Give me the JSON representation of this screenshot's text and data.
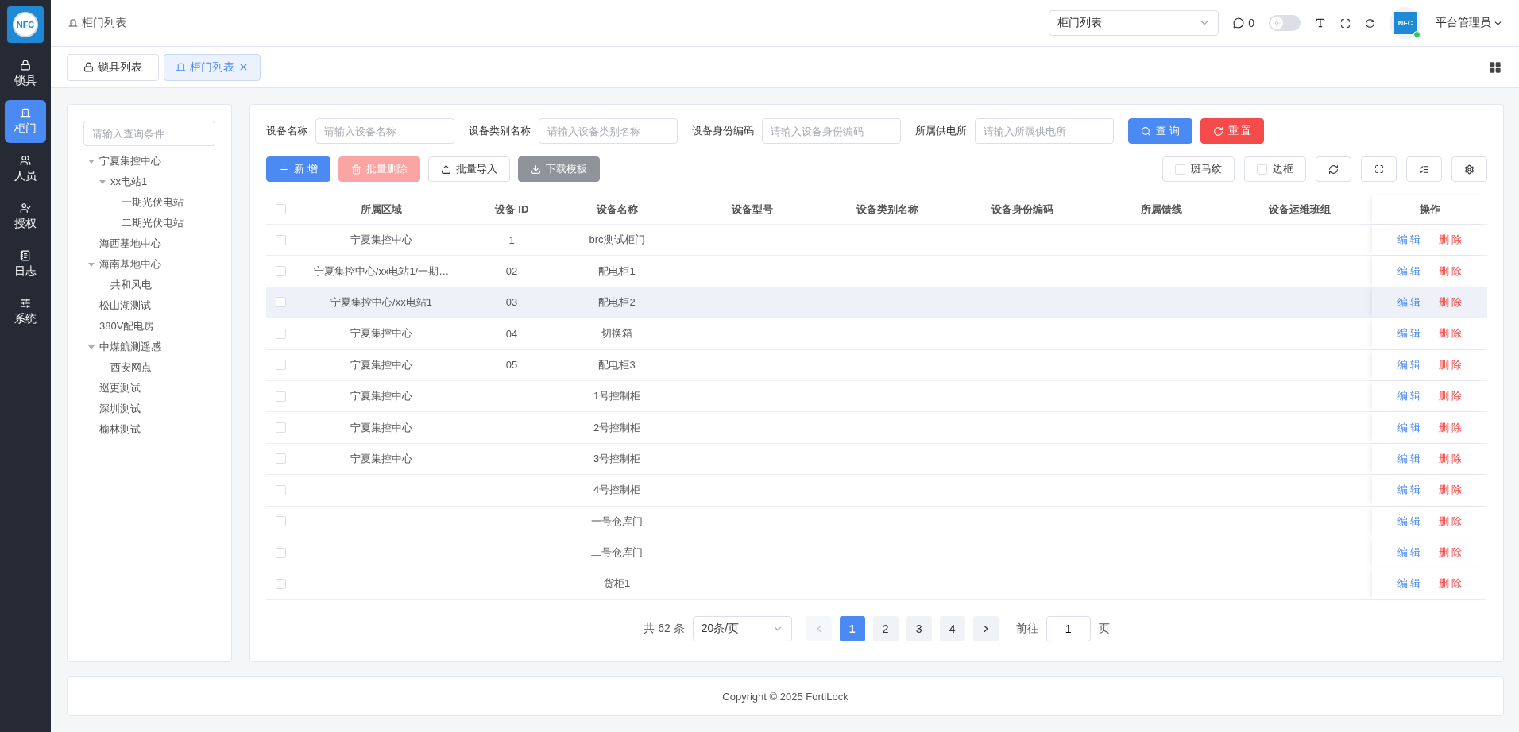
{
  "app": {
    "logo": "NFC"
  },
  "sidebar": {
    "items": [
      {
        "label": "锁具",
        "selected": false
      },
      {
        "label": "柜门",
        "selected": true
      },
      {
        "label": "人员",
        "selected": false
      },
      {
        "label": "授权",
        "selected": false
      },
      {
        "label": "日志",
        "selected": false
      },
      {
        "label": "系统",
        "selected": false
      }
    ]
  },
  "header": {
    "breadcrumb": "柜门列表",
    "menu_select": "柜门列表",
    "messages": "0",
    "dark_mode": {
      "on": false
    },
    "avatar": "NFC",
    "user": "平台管理员"
  },
  "tabs": [
    {
      "label": "锁具列表",
      "selected": false,
      "closable": false
    },
    {
      "label": "柜门列表",
      "selected": true,
      "closable": true
    }
  ],
  "tree": {
    "placeholder": "请输入查询条件",
    "nodes": [
      {
        "label": "宁夏集控中心",
        "expanded": true,
        "children": [
          {
            "label": "xx电站1",
            "expanded": true,
            "children": [
              {
                "label": "一期光伏电站"
              },
              {
                "label": "二期光伏电站"
              }
            ]
          }
        ]
      },
      {
        "label": "海西基地中心"
      },
      {
        "label": "海南基地中心",
        "expanded": true,
        "children": [
          {
            "label": "共和风电"
          }
        ]
      },
      {
        "label": "松山湖测试"
      },
      {
        "label": "380V配电房"
      },
      {
        "label": "中煤航测遥感",
        "expanded": true,
        "children": [
          {
            "label": "西安网点"
          }
        ]
      },
      {
        "label": "巡更测试"
      },
      {
        "label": "深圳测试"
      },
      {
        "label": "榆林测试"
      }
    ]
  },
  "filters": [
    {
      "label": "设备名称",
      "placeholder": "请输入设备名称"
    },
    {
      "label": "设备类别名称",
      "placeholder": "请输入设备类别名称"
    },
    {
      "label": "设备身份编码",
      "placeholder": "请输入设备身份编码"
    },
    {
      "label": "所属供电所",
      "placeholder": "请输入所属供电所"
    }
  ],
  "search_buttons": [
    {
      "label": "查 询",
      "kind": "query"
    },
    {
      "label": "重 置",
      "kind": "reset"
    }
  ],
  "actions": [
    {
      "label": "新 增",
      "kind": "primary",
      "disabled": false
    },
    {
      "label": "批量删除",
      "kind": "danger",
      "disabled": true
    },
    {
      "label": "批量导入",
      "kind": "plain",
      "disabled": false
    },
    {
      "label": "下载模板",
      "kind": "gray",
      "disabled": false
    }
  ],
  "table_options": [
    {
      "label": "斑马纹",
      "checked": false
    },
    {
      "label": "边框",
      "checked": false
    }
  ],
  "table": {
    "all_checked": false,
    "columns": [
      "所属区域",
      "设备 ID",
      "设备名称",
      "设备型号",
      "设备类别名称",
      "设备身份编码",
      "所属馈线",
      "设备运维班组",
      "操作"
    ],
    "rows": [
      {
        "area": "宁夏集控中心",
        "id": "1",
        "name": "brc测试柜门",
        "checked": false,
        "selected": false,
        "actions": [
          "编 辑",
          "删 除"
        ]
      },
      {
        "area": "宁夏集控中心/xx电站1/一期…",
        "id": "02",
        "name": "配电柜1",
        "checked": false,
        "selected": false,
        "actions": [
          "编 辑",
          "删 除"
        ]
      },
      {
        "area": "宁夏集控中心/xx电站1",
        "id": "03",
        "name": "配电柜2",
        "checked": false,
        "selected": true,
        "actions": [
          "编 辑",
          "删 除"
        ]
      },
      {
        "area": "宁夏集控中心",
        "id": "04",
        "name": "切换箱",
        "checked": false,
        "selected": false,
        "actions": [
          "编 辑",
          "删 除"
        ]
      },
      {
        "area": "宁夏集控中心",
        "id": "05",
        "name": "配电柜3",
        "checked": false,
        "selected": false,
        "actions": [
          "编 辑",
          "删 除"
        ]
      },
      {
        "area": "宁夏集控中心",
        "name": "1号控制柜",
        "checked": false,
        "selected": false,
        "actions": [
          "编 辑",
          "删 除"
        ]
      },
      {
        "area": "宁夏集控中心",
        "name": "2号控制柜",
        "checked": false,
        "selected": false,
        "actions": [
          "编 辑",
          "删 除"
        ]
      },
      {
        "area": "宁夏集控中心",
        "name": "3号控制柜",
        "checked": false,
        "selected": false,
        "actions": [
          "编 辑",
          "删 除"
        ]
      },
      {
        "name": "4号控制柜",
        "checked": false,
        "selected": false,
        "actions": [
          "编 辑",
          "删 除"
        ]
      },
      {
        "name": "一号仓库门",
        "checked": false,
        "selected": false,
        "actions": [
          "编 辑",
          "删 除"
        ]
      },
      {
        "name": "二号仓库门",
        "checked": false,
        "selected": false,
        "actions": [
          "编 辑",
          "删 除"
        ]
      },
      {
        "name": "货柜1",
        "checked": false,
        "selected": false,
        "actions": [
          "编 辑",
          "删 除"
        ]
      }
    ]
  },
  "pagination": {
    "total": "共 62 条",
    "page_size": "20条/页",
    "pages": [
      {
        "label": "1",
        "selected": true
      },
      {
        "label": "2",
        "selected": false
      },
      {
        "label": "3",
        "selected": false
      },
      {
        "label": "4",
        "selected": false
      }
    ],
    "goto_label": "前往",
    "goto_value": "1",
    "goto_suffix": "页"
  },
  "footer": "Copyright © 2025 FortiLock"
}
